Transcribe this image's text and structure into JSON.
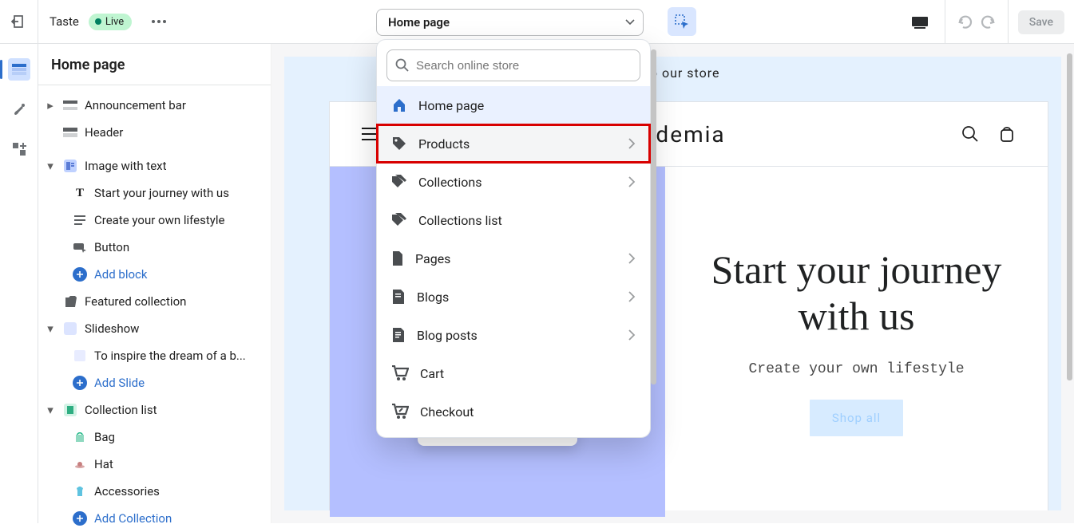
{
  "topbar": {
    "app_name": "Taste",
    "live_label": "Live",
    "page_selector_label": "Home page",
    "save_label": "Save"
  },
  "side": {
    "title": "Home page",
    "announcement_bar": "Announcement bar",
    "header": "Header",
    "image_with_text": "Image with text",
    "start_journey": "Start your journey with us",
    "create_lifestyle": "Create your own lifestyle",
    "button": "Button",
    "add_block": "Add block",
    "featured_collection": "Featured collection",
    "slideshow": "Slideshow",
    "slide_caption": "To inspire the dream of a b...",
    "add_slide": "Add Slide",
    "collection_list": "Collection list",
    "bag": "Bag",
    "hat": "Hat",
    "accessories": "Accessories",
    "add_collection": "Add Collection"
  },
  "popup": {
    "search_placeholder": "Search online store",
    "items": {
      "home": "Home page",
      "products": "Products",
      "collections": "Collections",
      "collections_list": "Collections list",
      "pages": "Pages",
      "blogs": "Blogs",
      "blog_posts": "Blog posts",
      "cart": "Cart",
      "checkout": "Checkout"
    }
  },
  "storefront": {
    "announcement": "ne to our store",
    "brand": "academia",
    "hero_title": "Start your journey with us",
    "hero_sub": "Create your own lifestyle",
    "hero_button": "Shop all"
  }
}
